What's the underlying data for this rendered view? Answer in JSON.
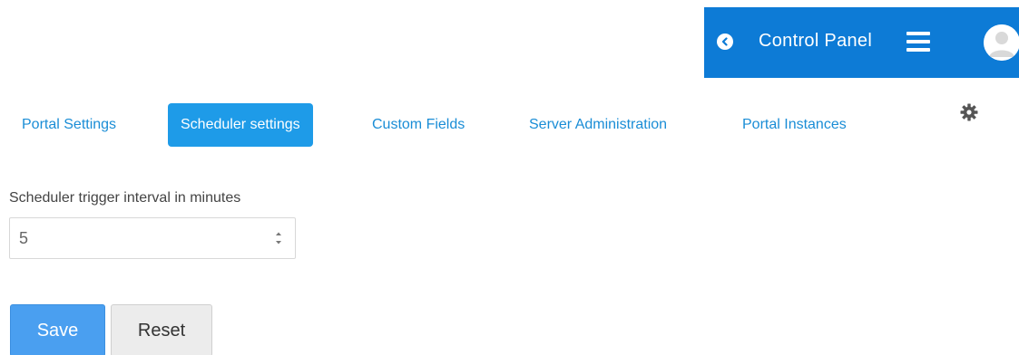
{
  "control_panel": {
    "title": "Control Panel",
    "back_icon": "chevron-left-circle-icon",
    "menu_icon": "hamburger-icon",
    "avatar_icon": "user-avatar-icon",
    "bar_color": "#0d7bd6"
  },
  "tabs": [
    {
      "label": "Portal Settings",
      "active": false
    },
    {
      "label": "Scheduler settings",
      "active": true
    },
    {
      "label": "Custom Fields",
      "active": false
    },
    {
      "label": "Server Administration",
      "active": false
    },
    {
      "label": "Portal Instances",
      "active": false
    }
  ],
  "settings_icon": "gear-icon",
  "form": {
    "interval_label": "Scheduler trigger interval in minutes",
    "interval_value": "5"
  },
  "buttons": {
    "save_label": "Save",
    "reset_label": "Reset"
  },
  "colors": {
    "accent": "#1e9be8",
    "link": "#1a8dd6",
    "save_button": "#4a9ff0"
  }
}
